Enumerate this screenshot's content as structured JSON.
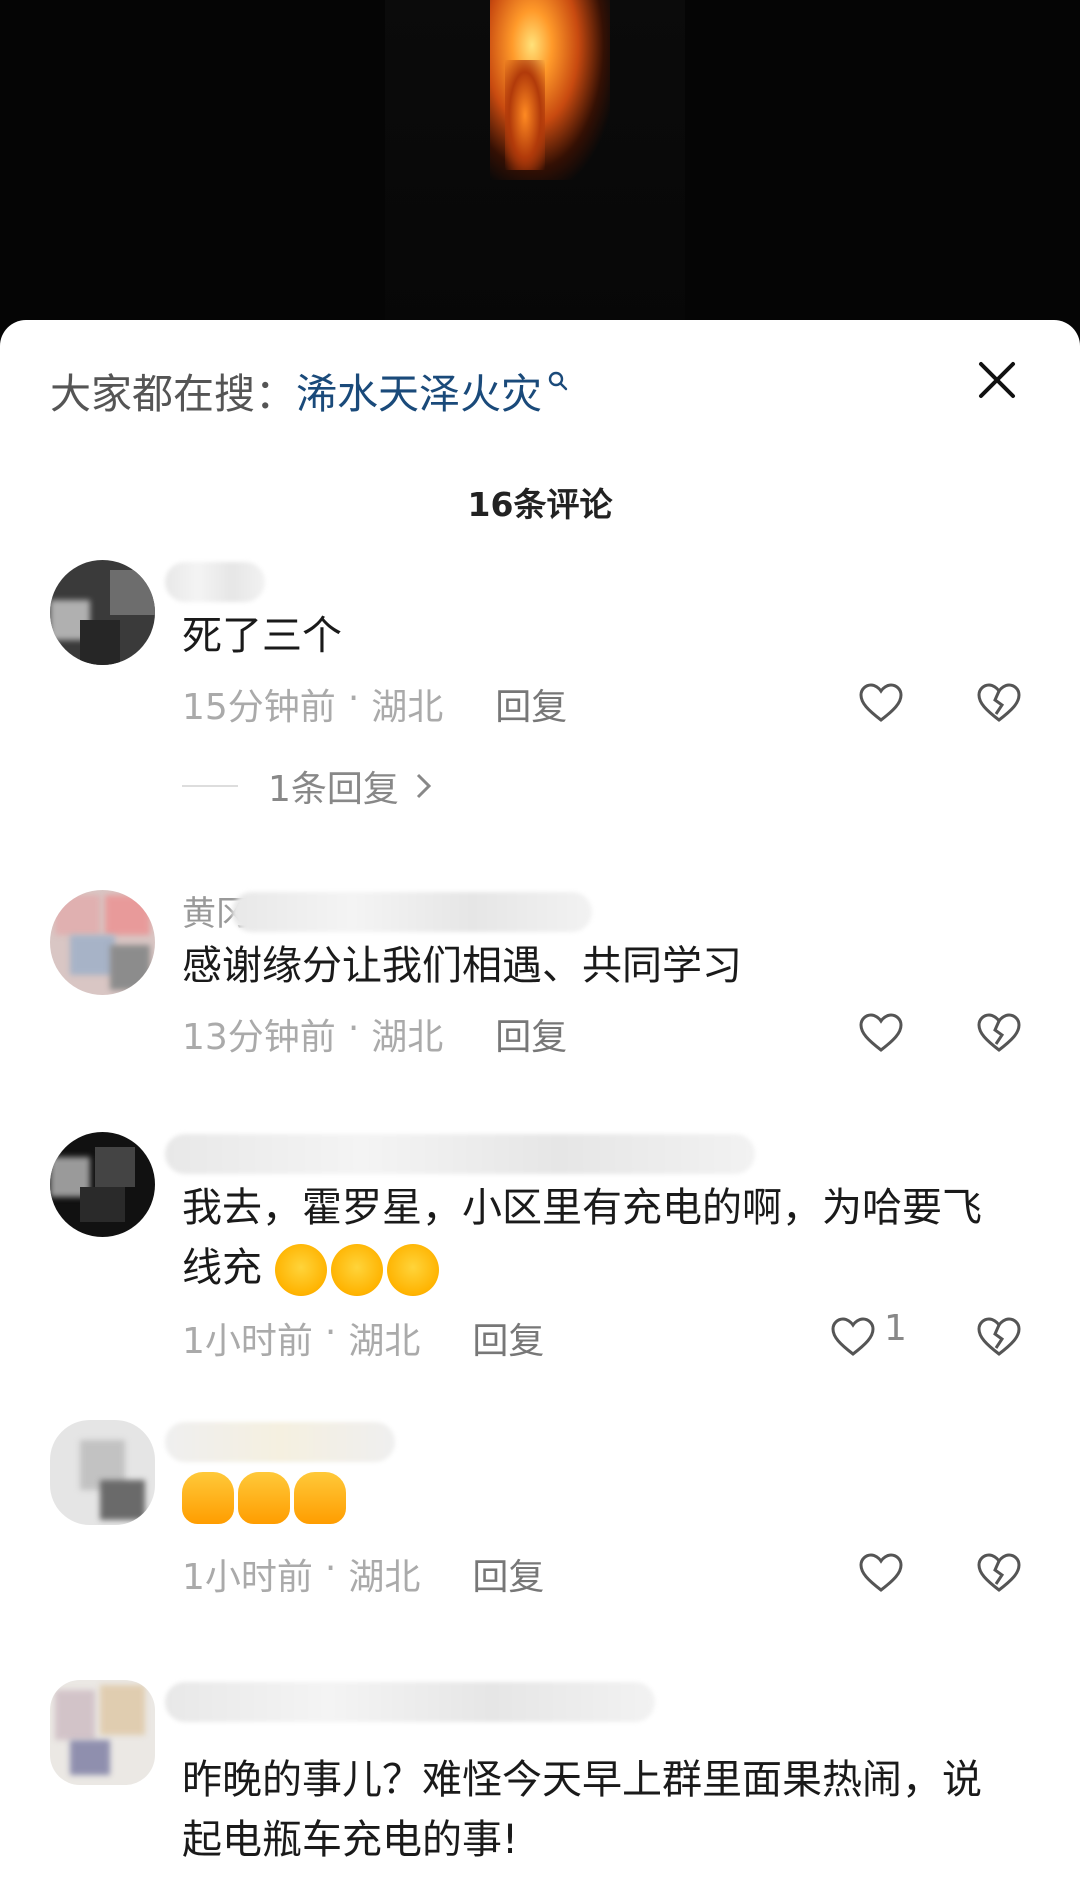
{
  "search_bar": {
    "prefix": "大家都在搜：",
    "term": "浠水天泽火灾"
  },
  "comment_count": "16条评论",
  "comments": [
    {
      "name": "",
      "text": "死了三个",
      "time": "15分钟前",
      "location": "湖北",
      "reply": "回复",
      "likes": "",
      "replies_label": "1条回复"
    },
    {
      "name": "黄冈",
      "text": "感谢缘分让我们相遇、共同学习",
      "time": "13分钟前",
      "location": "湖北",
      "reply": "回复",
      "likes": ""
    },
    {
      "name": "",
      "text": "我去，霍罗星，小区里有充电的啊，为哈要飞线充",
      "emojis": [
        "laugh-cry-emoji",
        "laugh-cry-emoji",
        "laugh-cry-emoji"
      ],
      "time": "1小时前",
      "location": "湖北",
      "reply": "回复",
      "likes": "1"
    },
    {
      "name": "",
      "text": "",
      "emojis": [
        "thumbs-up-emoji",
        "thumbs-up-emoji",
        "thumbs-up-emoji"
      ],
      "time": "1小时前",
      "location": "湖北",
      "reply": "回复",
      "likes": ""
    },
    {
      "name": "",
      "text": "昨晚的事儿？难怪今天早上群里面果热闹，说起电瓶车充电的事!",
      "time": "",
      "location": "",
      "reply": "",
      "likes": ""
    }
  ],
  "meta_separator": "·",
  "colors": {
    "search_term": "#1a4a7a",
    "meta_text": "#aaaaaa",
    "sheet_bg": "#ffffff",
    "video_bg": "#050505"
  }
}
